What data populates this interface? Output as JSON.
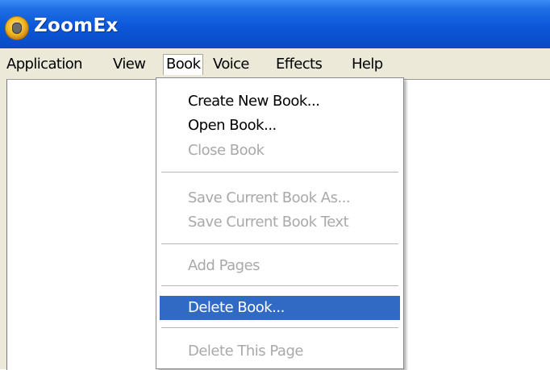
{
  "window": {
    "title": "ZoomEx",
    "icon": "zoomex-app-icon"
  },
  "menubar": {
    "items": [
      {
        "label": "Application"
      },
      {
        "label": "View"
      },
      {
        "label": "Book",
        "open": true
      },
      {
        "label": "Voice"
      },
      {
        "label": "Effects"
      },
      {
        "label": "Help"
      }
    ]
  },
  "book_menu": {
    "items": [
      {
        "label": "Create New Book...",
        "enabled": true
      },
      {
        "label": "Open Book...",
        "enabled": true
      },
      {
        "label": "Close Book",
        "enabled": false
      },
      {
        "label": "Save Current Book As...",
        "enabled": false
      },
      {
        "label": "Save Current Book Text",
        "enabled": false
      },
      {
        "label": "Add Pages",
        "enabled": false
      },
      {
        "label": "Delete Book...",
        "enabled": true,
        "highlighted": true
      },
      {
        "label": "Delete This Page",
        "enabled": false
      }
    ]
  },
  "colors": {
    "titlebar": "#0b57d8",
    "menu_highlight": "#316ac5",
    "disabled_text": "#a9a9a9"
  }
}
